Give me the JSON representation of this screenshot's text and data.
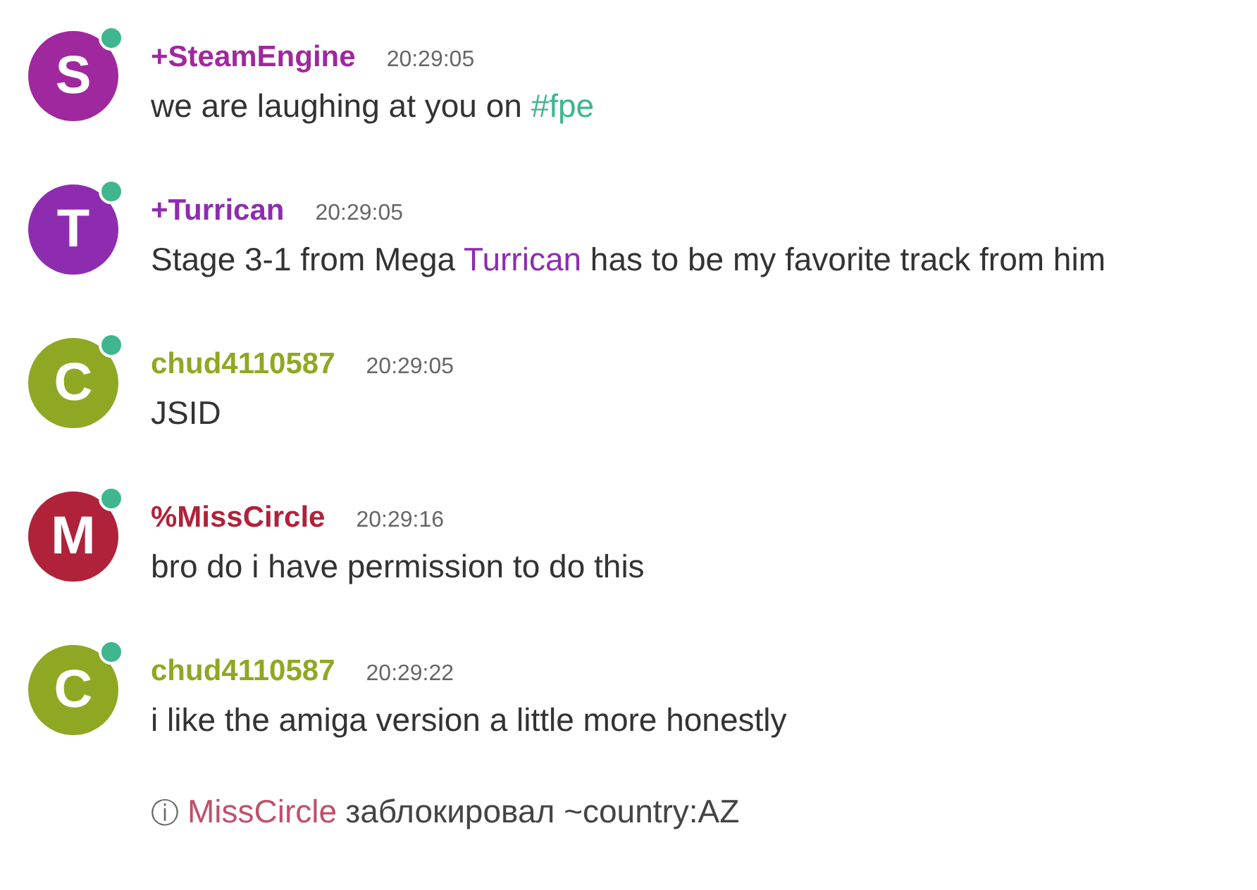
{
  "messages": [
    {
      "initial": "S",
      "color": "#a0289e",
      "online": true,
      "author": "+SteamEngine",
      "time": "20:29:05",
      "body": [
        {
          "text": "we are laughing at you on "
        },
        {
          "text": "#fpe",
          "color": "#3fb68e"
        }
      ]
    },
    {
      "initial": "T",
      "color": "#8e2cb0",
      "online": true,
      "author": "+Turrican",
      "time": "20:29:05",
      "body": [
        {
          "text": "Stage 3-1 from Mega "
        },
        {
          "text": "Turrican",
          "color": "#8e2cb0"
        },
        {
          "text": " has to be my favorite track from him"
        }
      ]
    },
    {
      "initial": "C",
      "color": "#8fa824",
      "online": true,
      "author": "chud4110587",
      "time": "20:29:05",
      "body": [
        {
          "text": "JSID"
        }
      ]
    },
    {
      "initial": "M",
      "color": "#b0223a",
      "online": true,
      "author": "%MissCircle",
      "time": "20:29:16",
      "body": [
        {
          "text": "bro do i have permission to do this"
        }
      ]
    },
    {
      "initial": "C",
      "color": "#8fa824",
      "online": true,
      "author": "chud4110587",
      "time": "20:29:22",
      "body": [
        {
          "text": "i like the amiga version a little more honestly"
        }
      ]
    }
  ],
  "notice": {
    "icon": "ⓘ",
    "user": "MissCircle",
    "text": "заблокировал ~country:AZ"
  }
}
